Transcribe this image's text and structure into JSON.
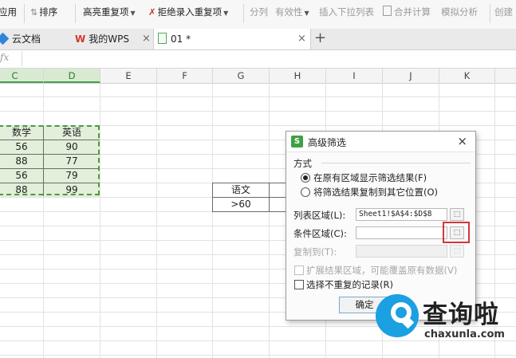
{
  "toolbar": {
    "items": [
      "应用",
      "排序",
      "高亮重复项",
      "拒绝录入重复项",
      "分列",
      "有效性",
      "插入下拉列表",
      "合并计算",
      "模拟分析",
      "创建"
    ]
  },
  "tabs": {
    "cloud": "云文档",
    "mywps": "我的WPS",
    "doc": "01 *",
    "close": "×",
    "plus": "+"
  },
  "formula_bar": {
    "fx": "fx",
    "value": ""
  },
  "columns": [
    "C",
    "D",
    "E",
    "F",
    "G",
    "H",
    "I",
    "J",
    "K"
  ],
  "sheet": {
    "table_headers": [
      "数学",
      "英语"
    ],
    "rows": [
      [
        "56",
        "90"
      ],
      [
        "88",
        "77"
      ],
      [
        "56",
        "79"
      ],
      [
        "88",
        "99"
      ]
    ],
    "criteria": {
      "header": "语文",
      "value": ">60"
    }
  },
  "dialog": {
    "title": "高级筛选",
    "close": "×",
    "section": "方式",
    "radio1": "在原有区域显示筛选结果(F)",
    "radio2": "将筛选结果复制到其它位置(O)",
    "list_range_label": "列表区域(L):",
    "list_range_value": "Sheet1!$A$4:$D$8",
    "criteria_range_label": "条件区域(C):",
    "criteria_range_value": "",
    "copy_to_label": "复制到(T):",
    "extend_label": "扩展结果区域，可能覆盖原有数据(V)",
    "unique_label": "选择不重复的记录(R)",
    "ok": "确定"
  },
  "watermark": {
    "title": "查询啦",
    "url": "chaxunla.com"
  },
  "colors": {
    "accent_green": "#4b9a3f",
    "selection_fill": "#e2efda",
    "highlight_red": "#d4363a",
    "watermark_blue": "#1ba0e1"
  }
}
